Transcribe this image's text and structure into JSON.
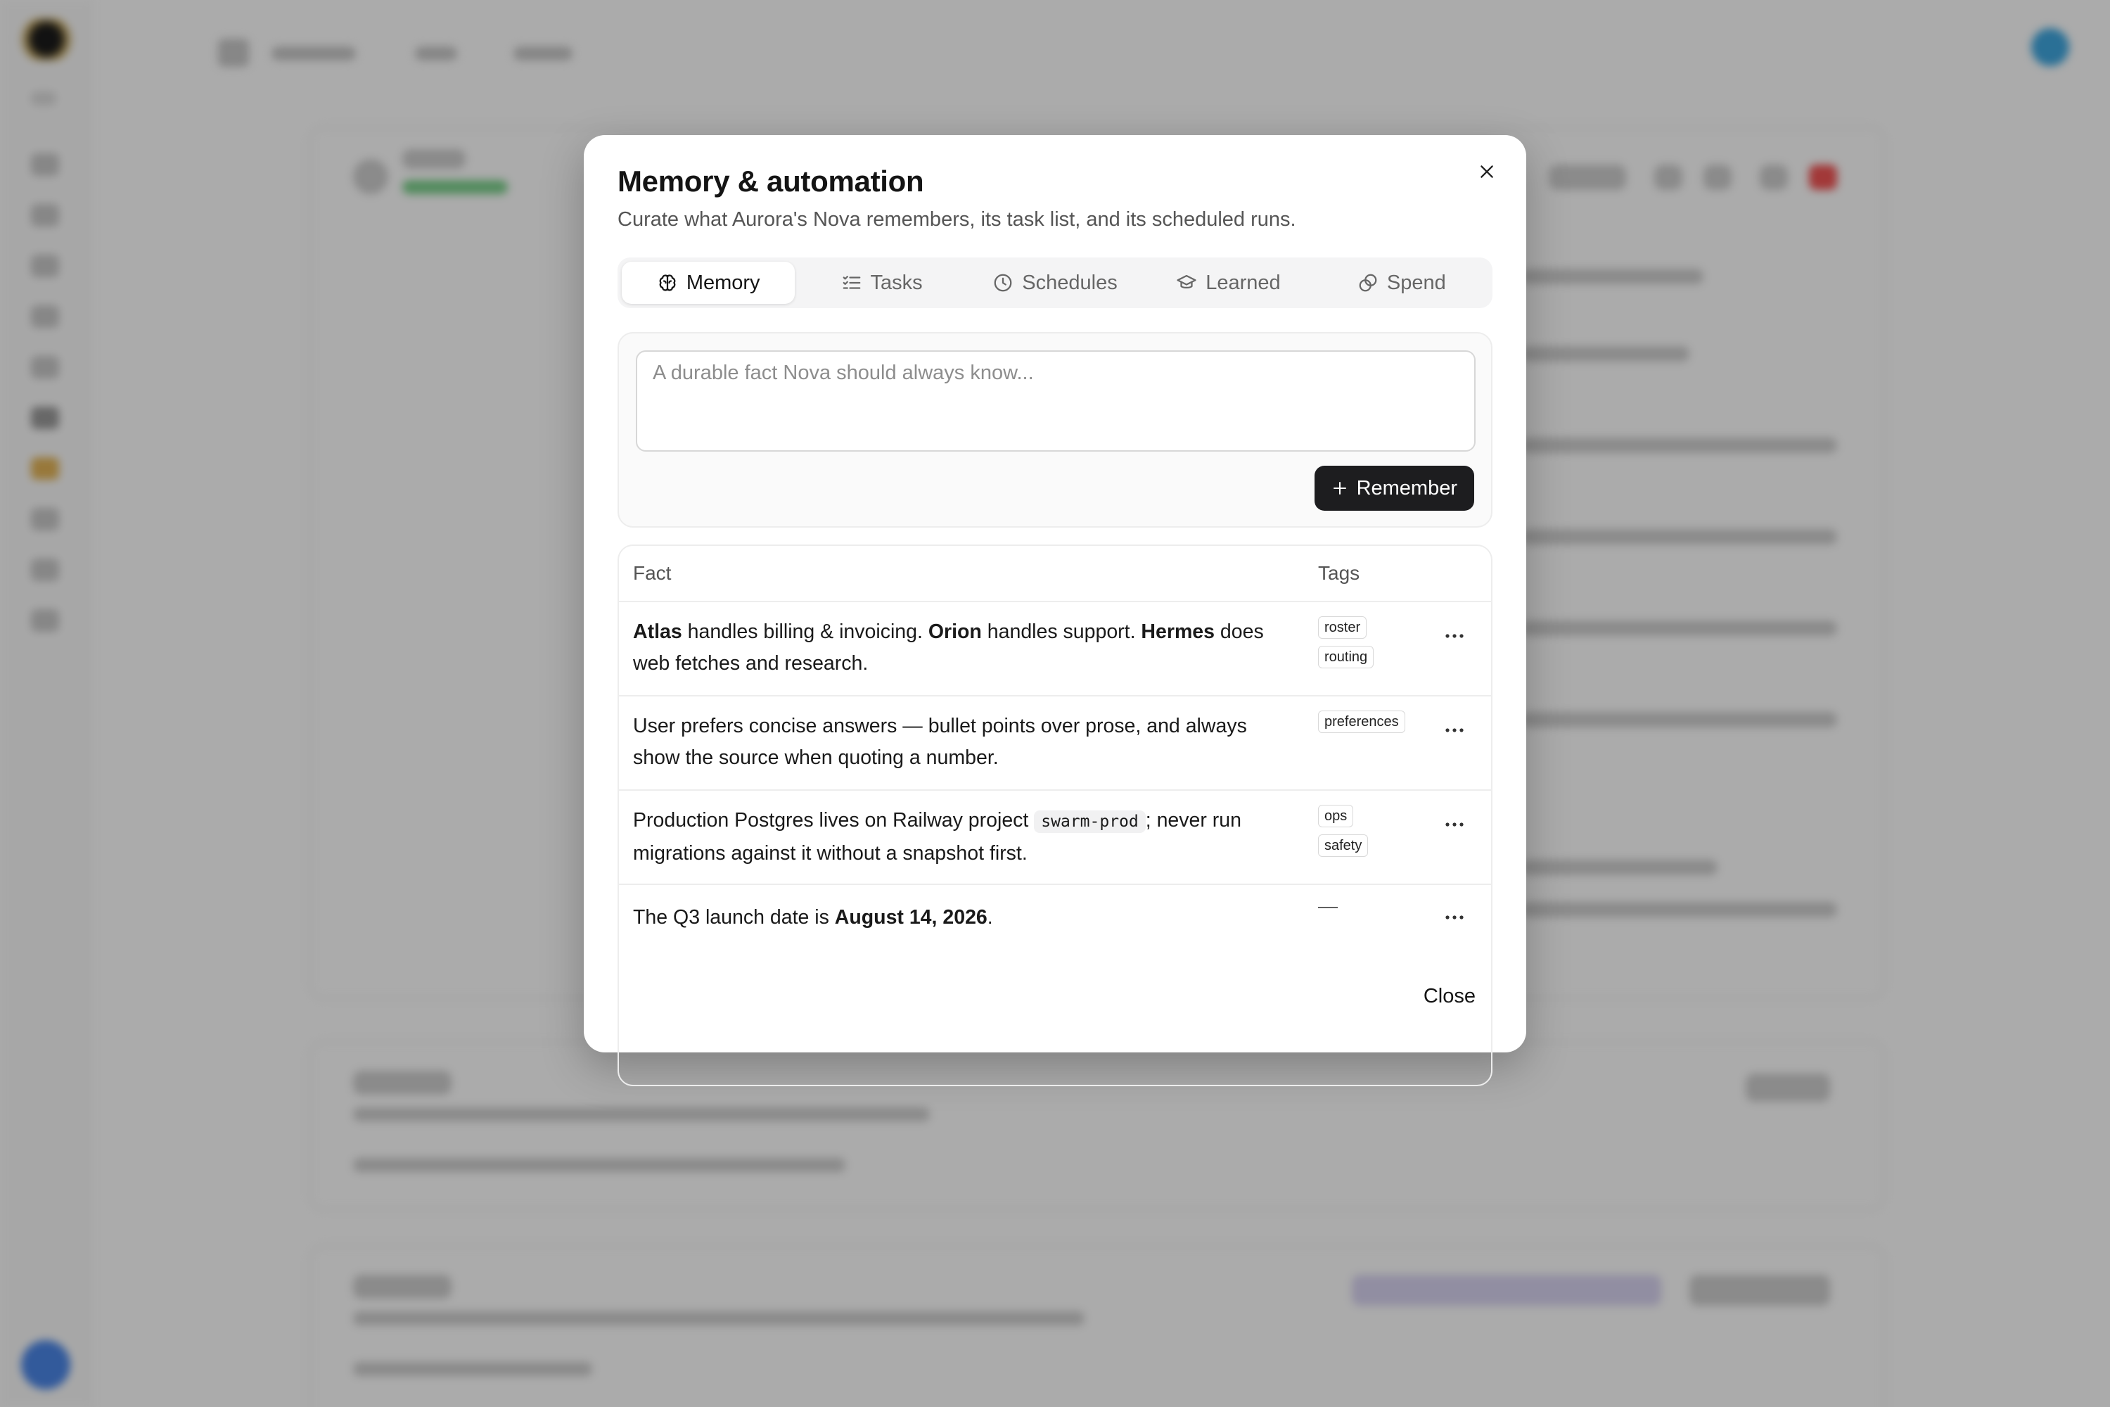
{
  "modal": {
    "title": "Memory & automation",
    "subtitle": "Curate what Aurora's Nova remembers, its task list, and its scheduled runs.",
    "close_icon": "close-icon",
    "tabs": [
      {
        "label": "Memory",
        "icon": "brain-icon",
        "active": true
      },
      {
        "label": "Tasks",
        "icon": "checklist-icon",
        "active": false
      },
      {
        "label": "Schedules",
        "icon": "clock-icon",
        "active": false
      },
      {
        "label": "Learned",
        "icon": "graduation-cap-icon",
        "active": false
      },
      {
        "label": "Spend",
        "icon": "coins-icon",
        "active": false
      }
    ],
    "composer": {
      "placeholder": "A durable fact Nova should always know...",
      "value": "",
      "button_label": "Remember",
      "button_icon": "plus-icon"
    },
    "facts_table": {
      "headers": {
        "fact": "Fact",
        "tags": "Tags"
      },
      "rows": [
        {
          "p1": "Atlas",
          "p2": " handles billing & invoicing. ",
          "p3": "Orion",
          "p4": " handles support. ",
          "p5": "Hermes",
          "p6": " does web fetches and research.",
          "tags": [
            "roster",
            "routing"
          ]
        },
        {
          "text": "User prefers concise answers — bullet points over prose, and always show the source when quoting a number.",
          "tags": [
            "preferences"
          ]
        },
        {
          "p1": "Production Postgres lives on Railway project ",
          "code": "swarm-prod",
          "p2": "; never run migrations against it without a snapshot first.",
          "tags": [
            "ops",
            "safety"
          ]
        },
        {
          "p1": "The Q3 launch date is ",
          "bold": "August 14, 2026",
          "p2": ".",
          "tags_empty": "—"
        }
      ],
      "row_menu_icon": "more-horizontal-icon"
    },
    "close_label": "Close"
  },
  "colors": {
    "primary_button": "#1d1d1f",
    "overlay": "rgba(0,0,0,0.33)",
    "tab_bar": "#f4f4f5"
  }
}
